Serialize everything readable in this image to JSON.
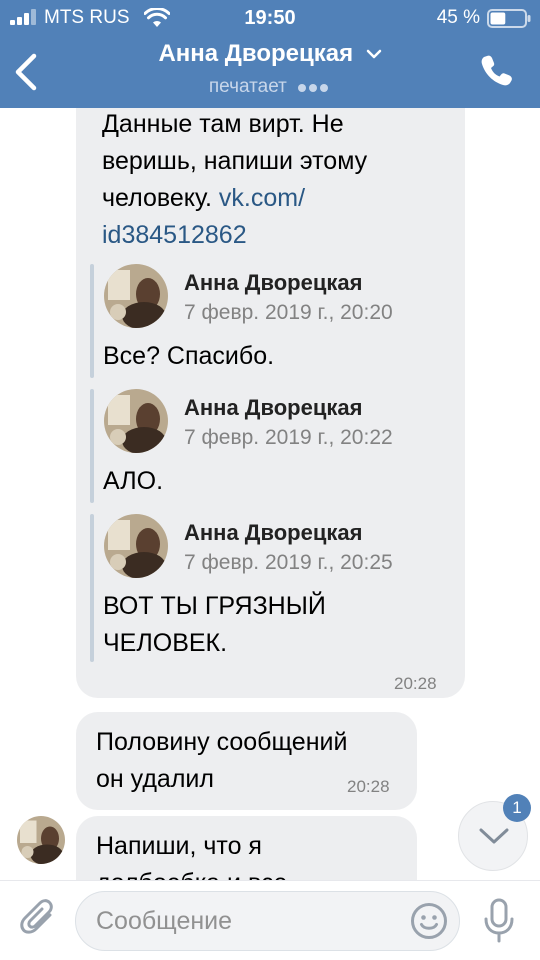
{
  "status_bar": {
    "carrier": "MTS RUS",
    "time": "19:50",
    "battery_percent": "45 %",
    "battery_level": 0.45
  },
  "header": {
    "contact_name": "Анна Дворецкая",
    "status": "печатает"
  },
  "messages": {
    "m1": {
      "line1": "Данные там вирт. Не",
      "line2": "веришь, напиши этому",
      "line3": "человеку.",
      "link1": "vk.com/",
      "link2": "id384512862",
      "time": "20:28",
      "forwarded": [
        {
          "author": "Анна Дворецкая",
          "date": "7 февр. 2019 г., 20:20",
          "line1": "Все? Спасибо.",
          "line2": ""
        },
        {
          "author": "Анна Дворецкая",
          "date": "7 февр. 2019 г., 20:22",
          "line1": "АЛО.",
          "line2": ""
        },
        {
          "author": "Анна Дворецкая",
          "date": "7 февр. 2019 г., 20:25",
          "line1": "ВОТ ТЫ ГРЯЗНЫЙ",
          "line2": "ЧЕЛОВЕК."
        }
      ]
    },
    "m2": {
      "line1": "Половину сообщений",
      "line2": "он удалил",
      "time": "20:28"
    },
    "m3": {
      "line1": "Напиши, что я",
      "line2": "долбоебка и все"
    }
  },
  "scroll_down": {
    "unread_count": "1"
  },
  "composer": {
    "placeholder": "Сообщение",
    "value": ""
  },
  "colors": {
    "header_bg": "#5181b8",
    "bubble_bg": "#edeef0",
    "link": "#2a5885",
    "muted": "#828282",
    "quote_line": "#c5d0db"
  },
  "icons": {
    "back": "chevron-left-icon",
    "call": "phone-icon",
    "attach": "paperclip-icon",
    "emoji": "smile-icon",
    "mic": "microphone-icon",
    "scroll": "chevron-down-icon"
  }
}
